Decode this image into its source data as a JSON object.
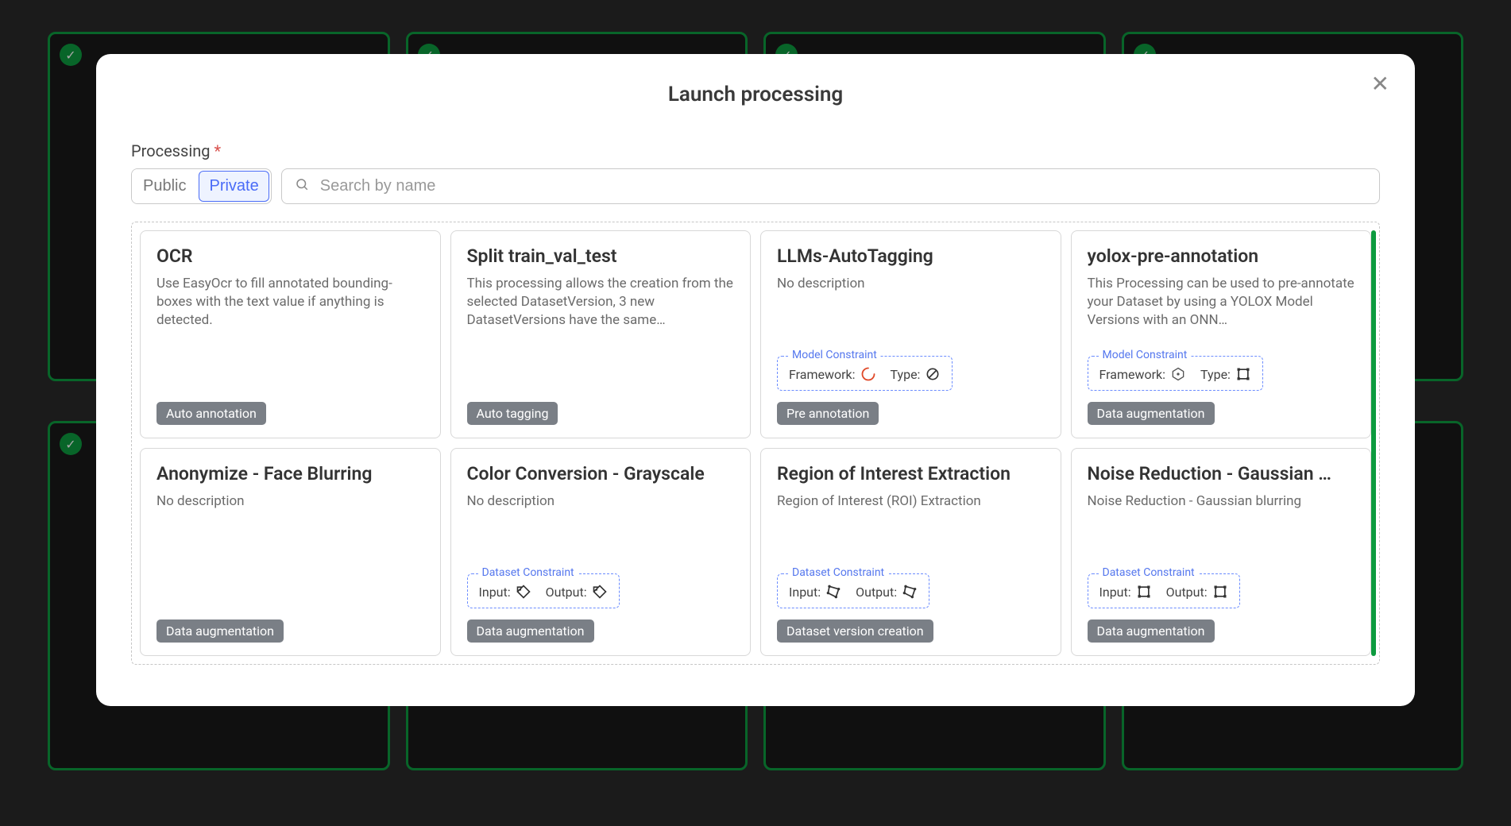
{
  "modal": {
    "title": "Launch processing",
    "field_label": "Processing",
    "required_mark": "*",
    "tabs": {
      "public": "Public",
      "private": "Private"
    },
    "search_placeholder": "Search by name"
  },
  "constraint_labels": {
    "model": "Model Constraint",
    "dataset": "Dataset Constraint",
    "framework": "Framework:",
    "type": "Type:",
    "input": "Input:",
    "output": "Output:"
  },
  "cards": [
    {
      "title": "OCR",
      "desc": "Use EasyOcr to fill annotated bounding-boxes with the text value if anything is detected.",
      "tag": "Auto annotation",
      "constraint": null
    },
    {
      "title": "Split train_val_test",
      "desc": "This processing allows the creation from the selected DatasetVersion, 3 new DatasetVersions have the same…",
      "tag": "Auto tagging",
      "constraint": null
    },
    {
      "title": "LLMs-AutoTagging",
      "desc": "No description",
      "tag": "Pre annotation",
      "constraint": {
        "kind": "model",
        "left_icon": "spinner",
        "right_icon": "noshape"
      }
    },
    {
      "title": "yolox-pre-annotation",
      "desc": "This Processing can be used to pre-annotate your Dataset by using a YOLOX Model Versions with an ONN…",
      "tag": "Data augmentation",
      "constraint": {
        "kind": "model",
        "left_icon": "onnx",
        "right_icon": "bbox"
      }
    },
    {
      "title": "Anonymize - Face Blurring",
      "desc": "No description",
      "tag": "Data augmentation",
      "constraint": null
    },
    {
      "title": "Color Conversion - Grayscale",
      "desc": "No description",
      "tag": "Data augmentation",
      "constraint": {
        "kind": "dataset",
        "left_icon": "tag",
        "right_icon": "tag"
      }
    },
    {
      "title": "Region of Interest Extraction",
      "desc": "Region of Interest (ROI) Extraction",
      "tag": "Dataset version creation",
      "constraint": {
        "kind": "dataset",
        "left_icon": "poly",
        "right_icon": "poly"
      }
    },
    {
      "title": "Noise Reduction - Gaussian …",
      "desc": "Noise Reduction - Gaussian blurring",
      "tag": "Data augmentation",
      "constraint": {
        "kind": "dataset",
        "left_icon": "bbox",
        "right_icon": "bbox"
      }
    }
  ]
}
